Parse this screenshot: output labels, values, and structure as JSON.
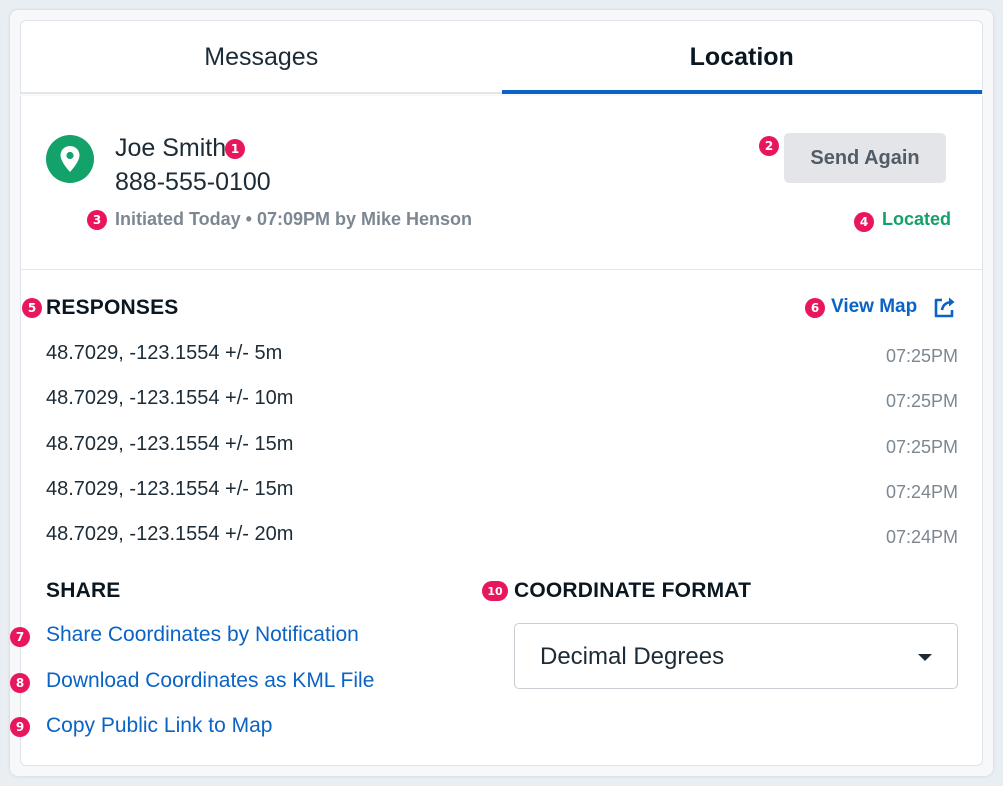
{
  "tabs": [
    {
      "label": "Messages",
      "active": false
    },
    {
      "label": "Location",
      "active": true
    }
  ],
  "contact": {
    "name": "Joe Smith",
    "phone": "888-555-0100",
    "initiated": "Initiated Today • 07:09PM by Mike Henson",
    "status": "Located"
  },
  "actions": {
    "send_again_label": "Send Again",
    "view_map_label": "View Map"
  },
  "badges": [
    "1",
    "2",
    "3",
    "4",
    "5",
    "6",
    "7",
    "8",
    "9",
    "10"
  ],
  "responses": {
    "title": "RESPONSES",
    "items": [
      {
        "coord": "48.7029, -123.1554 +/- 5m",
        "time": "07:25PM"
      },
      {
        "coord": "48.7029, -123.1554 +/- 10m",
        "time": "07:25PM"
      },
      {
        "coord": "48.7029, -123.1554 +/- 15m",
        "time": "07:25PM"
      },
      {
        "coord": "48.7029, -123.1554 +/- 15m",
        "time": "07:24PM"
      },
      {
        "coord": "48.7029, -123.1554 +/- 20m",
        "time": "07:24PM"
      }
    ]
  },
  "share": {
    "title": "SHARE",
    "links": [
      "Share Coordinates by Notification",
      "Download Coordinates as KML File",
      "Copy Public Link to Map"
    ]
  },
  "coordinate_format": {
    "title": "COORDINATE FORMAT",
    "selected": "Decimal Degrees"
  },
  "icons": {
    "pin": "map-pin-icon",
    "external": "external-link-icon",
    "caret": "caret-down-icon"
  },
  "colors": {
    "accent": "#0b63c4",
    "success": "#12a26a",
    "badge": "#e8175d",
    "muted": "#7c8791"
  }
}
